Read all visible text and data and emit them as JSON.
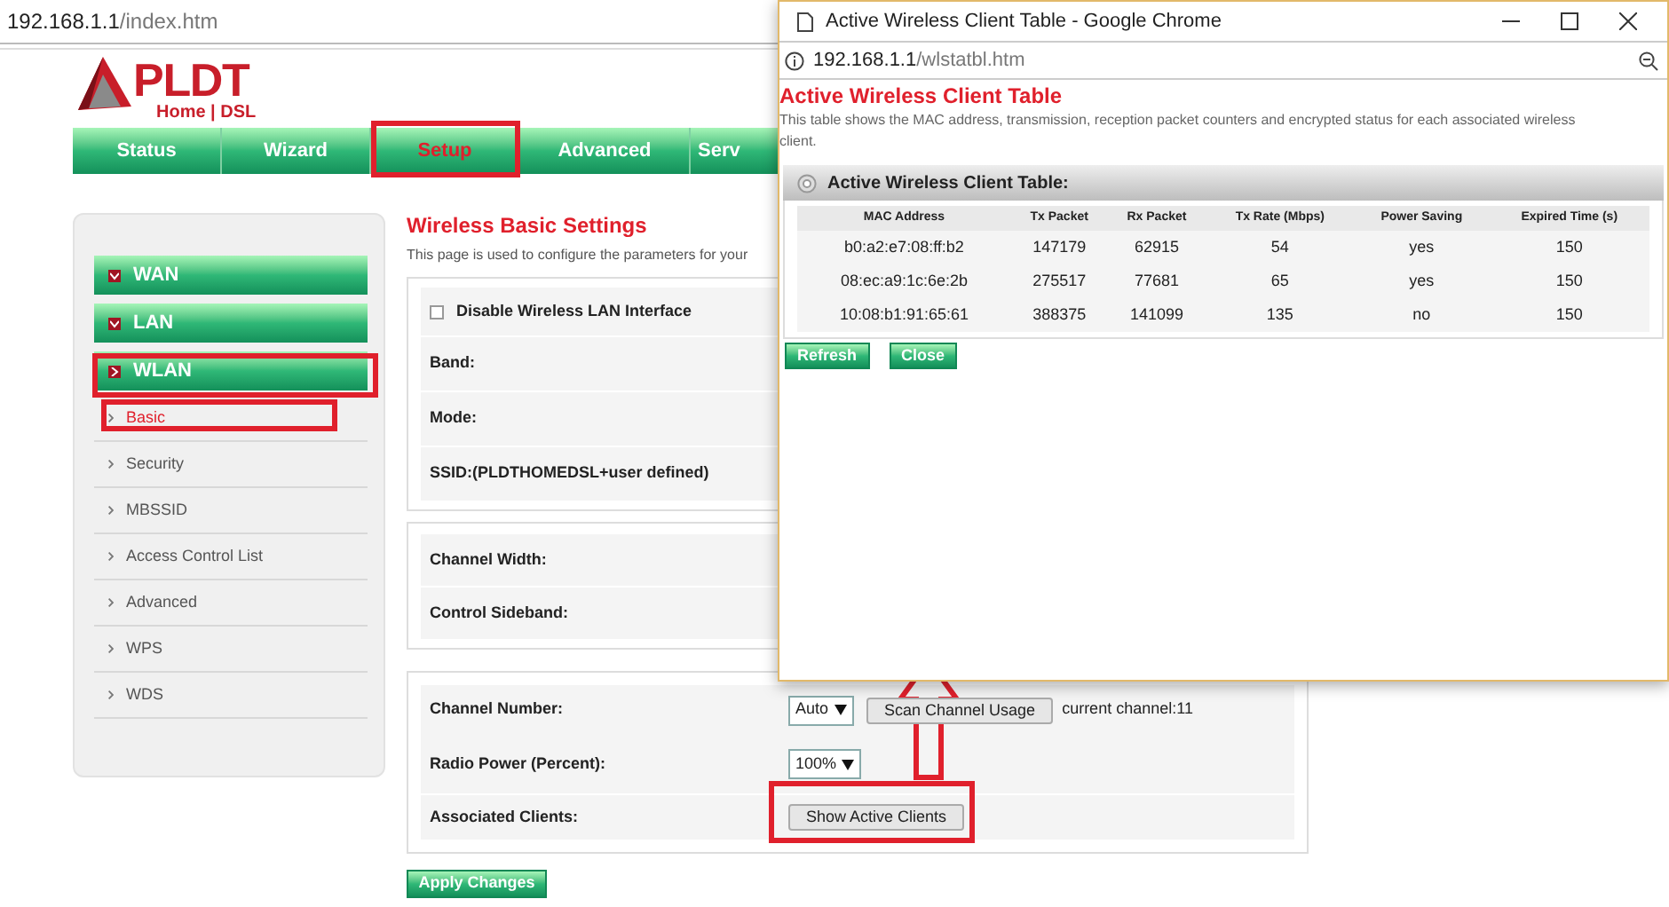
{
  "browser": {
    "url_host": "192.168.1.1",
    "url_path": "/index.htm"
  },
  "logo": {
    "brand": "PLDT",
    "subtitle": "Home | DSL"
  },
  "nav": [
    {
      "label": "Status",
      "selected": false
    },
    {
      "label": "Wizard",
      "selected": false
    },
    {
      "label": "Setup",
      "selected": true
    },
    {
      "label": "Advanced",
      "selected": false
    },
    {
      "label": "Serv",
      "selected": false
    }
  ],
  "sidebar": {
    "groups": [
      {
        "label": "WAN",
        "expanded": false
      },
      {
        "label": "LAN",
        "expanded": false
      },
      {
        "label": "WLAN",
        "expanded": true,
        "children": [
          {
            "label": "Basic",
            "selected": true
          },
          {
            "label": "Security",
            "selected": false
          },
          {
            "label": "MBSSID",
            "selected": false
          },
          {
            "label": "Access Control List",
            "selected": false
          },
          {
            "label": "Advanced",
            "selected": false
          },
          {
            "label": "WPS",
            "selected": false
          },
          {
            "label": "WDS",
            "selected": false
          }
        ]
      }
    ]
  },
  "content": {
    "title": "Wireless Basic Settings",
    "description": "This page is used to configure the parameters for your",
    "section_1": {
      "checkbox": {
        "label": "Disable Wireless LAN Interface",
        "checked": false
      },
      "fields": [
        "Band:",
        "Mode:",
        "SSID:(PLDTHOMEDSL+user defined)"
      ]
    },
    "section_2": {
      "fields": [
        "Channel Width:",
        "Control Sideband:"
      ]
    },
    "section_3": {
      "channel_number": {
        "label": "Channel Number:",
        "value": "Auto",
        "button": "Scan Channel Usage",
        "current": "current channel:11"
      },
      "radio_power": {
        "label": "Radio Power (Percent):",
        "value": "100%"
      },
      "associated_clients": {
        "label": "Associated Clients:",
        "button": "Show Active Clients"
      }
    },
    "apply_button": "Apply Changes"
  },
  "popup": {
    "window_title": "Active Wireless Client Table - Google Chrome",
    "url_host": "192.168.1.1",
    "url_path": "/wlstatbl.htm",
    "title": "Active Wireless Client Table",
    "description": "This table shows the MAC address, transmission, reception packet counters and encrypted status for each associated wireless client.",
    "panel_title": "Active Wireless Client Table:",
    "table": {
      "columns": [
        "MAC Address",
        "Tx Packet",
        "Rx Packet",
        "Tx Rate (Mbps)",
        "Power Saving",
        "Expired Time (s)"
      ],
      "rows": [
        [
          "b0:a2:e7:08:ff:b2",
          "147179",
          "62915",
          "54",
          "yes",
          "150"
        ],
        [
          "08:ec:a9:1c:6e:2b",
          "275517",
          "77681",
          "65",
          "yes",
          "150"
        ],
        [
          "10:08:b1:91:65:61",
          "388375",
          "141099",
          "135",
          "no",
          "150"
        ]
      ]
    },
    "buttons": [
      "Refresh",
      "Close"
    ]
  }
}
